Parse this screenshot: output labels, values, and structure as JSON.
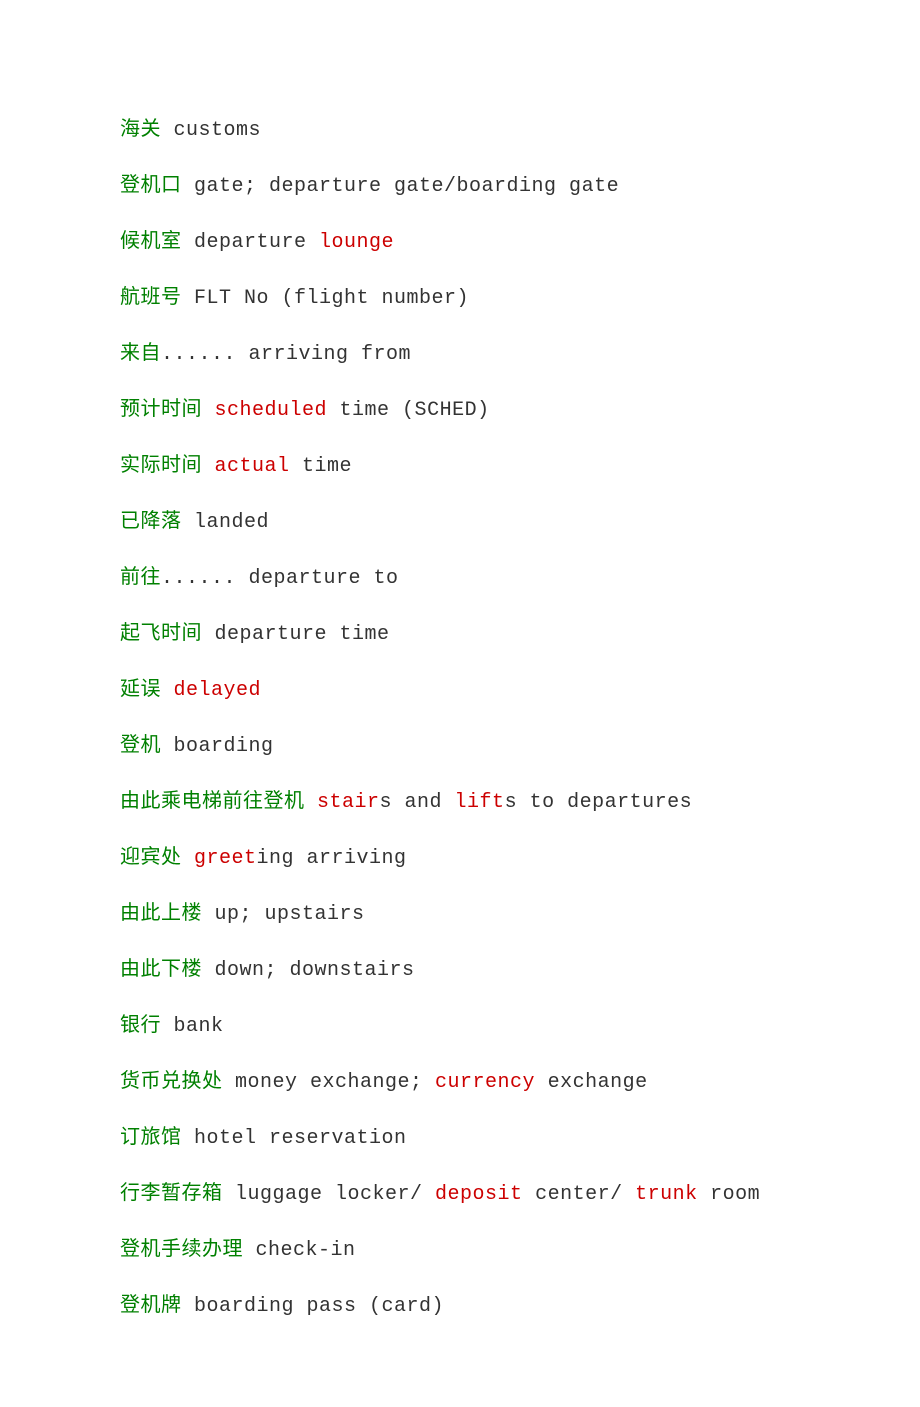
{
  "lines": [
    {
      "parts": [
        {
          "t": "海关",
          "c": "zh"
        },
        {
          "t": " customs",
          "c": "en"
        }
      ]
    },
    {
      "parts": [
        {
          "t": "登机口",
          "c": "zh"
        },
        {
          "t": " gate; departure gate/boarding gate",
          "c": "en"
        }
      ]
    },
    {
      "parts": [
        {
          "t": "候机室",
          "c": "zh"
        },
        {
          "t": " departure ",
          "c": "en"
        },
        {
          "t": "lounge",
          "c": "red"
        }
      ]
    },
    {
      "parts": [
        {
          "t": "航班号",
          "c": "zh"
        },
        {
          "t": " FLT No (flight number)",
          "c": "en"
        }
      ]
    },
    {
      "parts": [
        {
          "t": "来自",
          "c": "zh"
        },
        {
          "t": "...... arriving from",
          "c": "en"
        }
      ]
    },
    {
      "parts": [
        {
          "t": "预计时间",
          "c": "zh"
        },
        {
          "t": " ",
          "c": "en"
        },
        {
          "t": "scheduled",
          "c": "red"
        },
        {
          "t": " time (SCHED)",
          "c": "en"
        }
      ]
    },
    {
      "parts": [
        {
          "t": "实际时间",
          "c": "zh"
        },
        {
          "t": " ",
          "c": "en"
        },
        {
          "t": "actual",
          "c": "red"
        },
        {
          "t": " time",
          "c": "en"
        }
      ]
    },
    {
      "parts": [
        {
          "t": "已降落",
          "c": "zh"
        },
        {
          "t": " landed",
          "c": "en"
        }
      ]
    },
    {
      "parts": [
        {
          "t": "前往",
          "c": "zh"
        },
        {
          "t": "...... departure to",
          "c": "en"
        }
      ]
    },
    {
      "parts": [
        {
          "t": "起飞时间",
          "c": "zh"
        },
        {
          "t": " departure time",
          "c": "en"
        }
      ]
    },
    {
      "parts": [
        {
          "t": "延误",
          "c": "zh"
        },
        {
          "t": " ",
          "c": "en"
        },
        {
          "t": "delayed",
          "c": "red"
        }
      ]
    },
    {
      "parts": [
        {
          "t": "登机",
          "c": "zh"
        },
        {
          "t": " boarding",
          "c": "en"
        }
      ]
    },
    {
      "parts": [
        {
          "t": "由此乘电梯前往登机",
          "c": "zh"
        },
        {
          "t": " ",
          "c": "en"
        },
        {
          "t": "stair",
          "c": "red"
        },
        {
          "t": "s and ",
          "c": "en"
        },
        {
          "t": "lift",
          "c": "red"
        },
        {
          "t": "s to departures",
          "c": "en"
        }
      ]
    },
    {
      "parts": [
        {
          "t": "迎宾处",
          "c": "zh"
        },
        {
          "t": " ",
          "c": "en"
        },
        {
          "t": "greet",
          "c": "red"
        },
        {
          "t": "ing arriving",
          "c": "en"
        }
      ]
    },
    {
      "parts": [
        {
          "t": "由此上楼",
          "c": "zh"
        },
        {
          "t": " up; upstairs",
          "c": "en"
        }
      ]
    },
    {
      "parts": [
        {
          "t": "由此下楼",
          "c": "zh"
        },
        {
          "t": " down; downstairs",
          "c": "en"
        }
      ]
    },
    {
      "parts": [
        {
          "t": "银行",
          "c": "zh"
        },
        {
          "t": " bank",
          "c": "en"
        }
      ]
    },
    {
      "parts": [
        {
          "t": "货币兑换处",
          "c": "zh"
        },
        {
          "t": " money exchange; ",
          "c": "en"
        },
        {
          "t": "currency",
          "c": "red"
        },
        {
          "t": " exchange",
          "c": "en"
        }
      ]
    },
    {
      "parts": [
        {
          "t": "订旅馆",
          "c": "zh"
        },
        {
          "t": " hotel reservation",
          "c": "en"
        }
      ]
    },
    {
      "parts": [
        {
          "t": "行李暂存箱",
          "c": "zh"
        },
        {
          "t": " luggage locker/ ",
          "c": "en"
        },
        {
          "t": "deposit",
          "c": "red"
        },
        {
          "t": " center/ ",
          "c": "en"
        },
        {
          "t": "trunk",
          "c": "red"
        },
        {
          "t": " room",
          "c": "en"
        }
      ]
    },
    {
      "parts": [
        {
          "t": "登机手续办理",
          "c": "zh"
        },
        {
          "t": " check-in",
          "c": "en"
        }
      ]
    },
    {
      "parts": [
        {
          "t": "登机牌",
          "c": "zh"
        },
        {
          "t": " boarding pass (card)",
          "c": "en"
        }
      ]
    }
  ]
}
